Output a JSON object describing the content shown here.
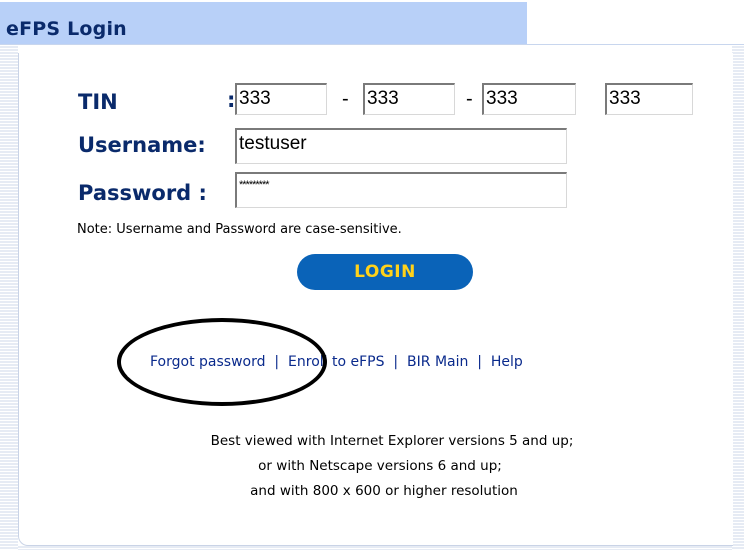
{
  "window": {
    "title": "eFPS Login"
  },
  "form": {
    "tin_label": "TIN",
    "tin_colon": ":",
    "tin_values": [
      "333",
      "333",
      "333",
      "333"
    ],
    "tin_separator": "-",
    "username_label": "Username:",
    "username_value": "testuser",
    "password_label": "Password :",
    "password_mask": "*********",
    "note": "Note: Username and Password are case-sensitive.",
    "login_label": "LOGIN"
  },
  "links": {
    "forgot_password": "Forgot password",
    "enroll": "Enroll to eFPS",
    "bir_main": "BIR Main",
    "help": "Help",
    "separator": "|"
  },
  "footer": {
    "line1": "Best viewed with Internet Explorer versions 5 and up;",
    "line2": "or with Netscape versions 6 and up;",
    "line3": "and with 800 x 600 or higher resolution"
  },
  "colors": {
    "title_bar": "#b8d0f8",
    "label_text": "#0a2a6b",
    "button_bg": "#0a63b8",
    "button_text": "#ffd21a",
    "link_text": "#0a2a8c",
    "annotation_circle": "#000000"
  }
}
